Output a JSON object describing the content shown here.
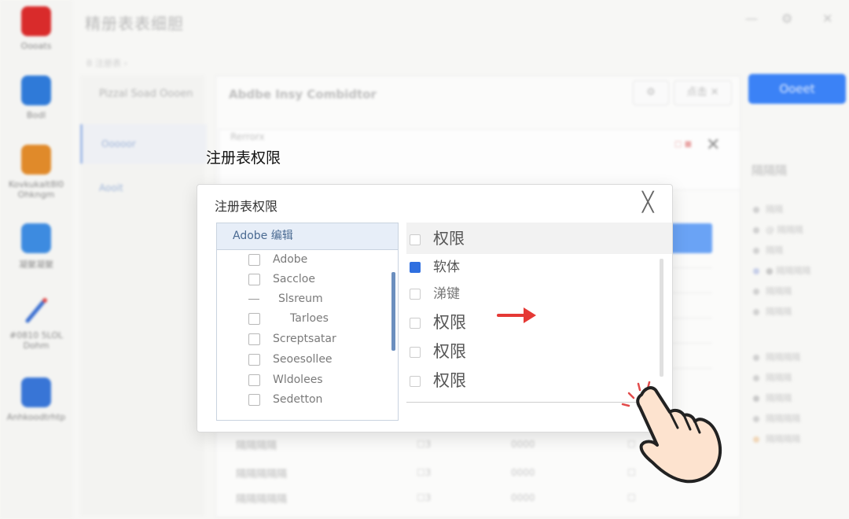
{
  "background": {
    "window_title": "精册表表细胆",
    "window_controls": [
      "—",
      "⚙",
      "✕"
    ],
    "breadcrumb": "B 注册表 ›",
    "dock": [
      {
        "label": "Oooats",
        "icon": "adobe-app-icon",
        "color": "#d92b2b"
      },
      {
        "label": "Bodl",
        "icon": "cube-app-icon",
        "color": "#2f7ad8"
      },
      {
        "label": "Kovkukalt8l0 Ohkngm",
        "icon": "orange-app-icon",
        "color": "#e08a2a"
      },
      {
        "label": "凝聚凝聚",
        "icon": "cloud-app-icon",
        "color": "#3d8be0"
      },
      {
        "label": "#0810 5LOL Dohm",
        "icon": "brush-app-icon",
        "color": "#3b6fd1"
      },
      {
        "label": "Anhkoodtrhtp",
        "icon": "star-app-icon",
        "color": "#3875d6"
      }
    ],
    "side_panel": {
      "heading": "Pizzal Soad Oooen",
      "items": [
        {
          "label": "Ooooor",
          "active": true
        },
        {
          "label": "Aooit",
          "active": false
        }
      ]
    },
    "content": {
      "title": "Abdbe Insy Combidtor",
      "gear": "⚙",
      "small_btn": "点击 ✕",
      "mid_close": "✕",
      "mid_tag": "□ ■",
      "mid_label": "Rerrorx"
    },
    "primary_button": "Ooeet",
    "right_panel": {
      "title": "隔隔隔",
      "items": [
        "隔隔",
        "@ 隔隔隔",
        "隔隔",
        "● 隔隔隔隔",
        "隔隔隔",
        "隔隔隔",
        "隔隔隔隔",
        "隔隔隔",
        "隔隔隔",
        "隔隔隔隔",
        "隔隔隔隔"
      ],
      "colors": [
        "#cfcfcf",
        "#cfcfcf",
        "#d0d0d0",
        "#c5cde8",
        "#d0d0d0",
        "#d0d0d0",
        "#cfcfcf",
        "#d0d0d0",
        "#c8c8c8",
        "#d0d0d0",
        "#f0d6b8"
      ]
    },
    "rows": [
      {
        "label": "隔隔隔隔",
        "c1": "☐3",
        "c2": "0000",
        "c3": "☐"
      },
      {
        "label": "隔隔隔隔隔",
        "c1": "☐3",
        "c2": "0000",
        "c3": "☐"
      },
      {
        "label": "隔隔隔隔隔",
        "c1": "☐3",
        "c2": "0000",
        "c3": "☐"
      }
    ]
  },
  "floating_label": "注册表权限",
  "dialog": {
    "title": "注册表权限",
    "close": "╳",
    "left_list": {
      "header": "Adobe 编辑",
      "items": [
        {
          "label": "Adobe",
          "marker": "checkbox"
        },
        {
          "label": "Saccloe",
          "marker": "checkbox"
        },
        {
          "label": "Slsreum",
          "marker": "dash"
        },
        {
          "label": "Tarloes",
          "marker": "checkbox"
        },
        {
          "label": "Screptsatar",
          "marker": "checkbox"
        },
        {
          "label": "Seoesollee",
          "marker": "checkbox"
        },
        {
          "label": "Wldolees",
          "marker": "checkbox"
        },
        {
          "label": "Sedetton",
          "marker": "checkbox"
        }
      ]
    },
    "right_list": {
      "items": [
        {
          "label": "权限",
          "checked": false
        },
        {
          "label": "软体",
          "checked": true
        },
        {
          "label": "涕键",
          "checked": false
        },
        {
          "label": "权限",
          "checked": false
        },
        {
          "label": "权限",
          "checked": false
        },
        {
          "label": "权限",
          "checked": false
        }
      ]
    }
  },
  "accent": {
    "arrow": "#e53935",
    "checkbox": "#2f6fe0",
    "hand_fill": "#fde3cf",
    "hand_stroke": "#222222"
  }
}
